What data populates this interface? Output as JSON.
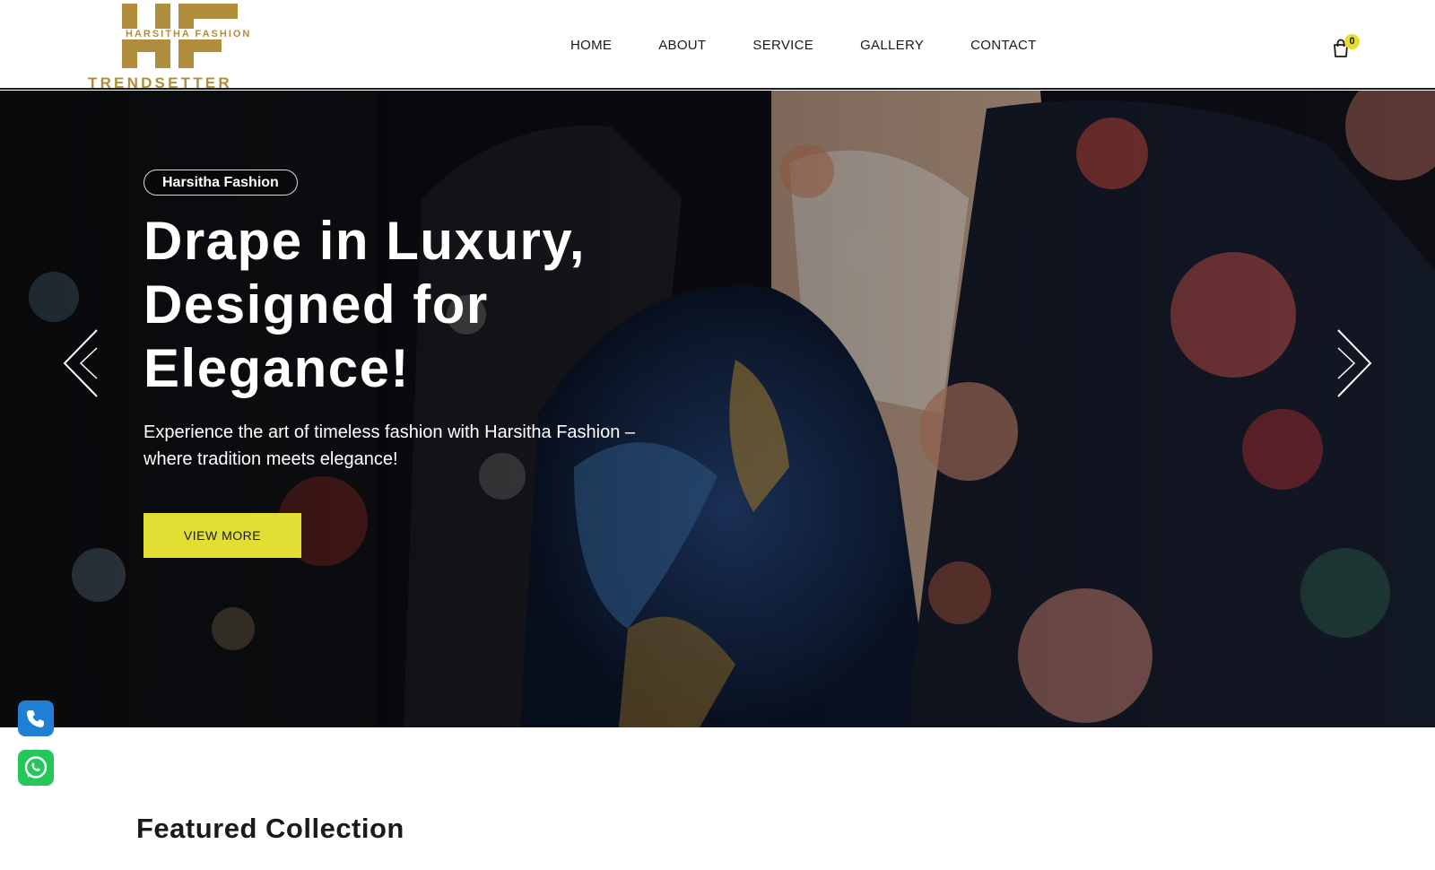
{
  "header": {
    "logo": {
      "monogram": "HF",
      "tagline": "HARSITHA FASHION",
      "wordmark": "TRENDSETTER",
      "color": "#b08d3c"
    },
    "nav": [
      {
        "label": "HOME"
      },
      {
        "label": "ABOUT"
      },
      {
        "label": "SERVICE"
      },
      {
        "label": "GALLERY"
      },
      {
        "label": "CONTACT"
      }
    ],
    "cart": {
      "icon": "shopping-bag-icon",
      "count": "0",
      "badge_color": "#e5de2f"
    }
  },
  "hero": {
    "eyebrow": "Harsitha Fashion",
    "headline_lines": [
      "Drape in Luxury,",
      "Designed for",
      "Elegance!"
    ],
    "subtext_lines": [
      "Experience the art of timeless fashion with Harsitha Fashion –",
      "where tradition meets elegance!"
    ],
    "cta_label": "VIEW MORE",
    "cta_color": "#e3de33",
    "prev_icon": "chevron-left-icon",
    "next_icon": "chevron-right-icon"
  },
  "floating": {
    "phone": {
      "icon": "phone-icon",
      "color": "#1f7fd4"
    },
    "whatsapp": {
      "icon": "whatsapp-icon",
      "color": "#25c75a"
    }
  },
  "featured": {
    "title": "Featured Collection"
  }
}
